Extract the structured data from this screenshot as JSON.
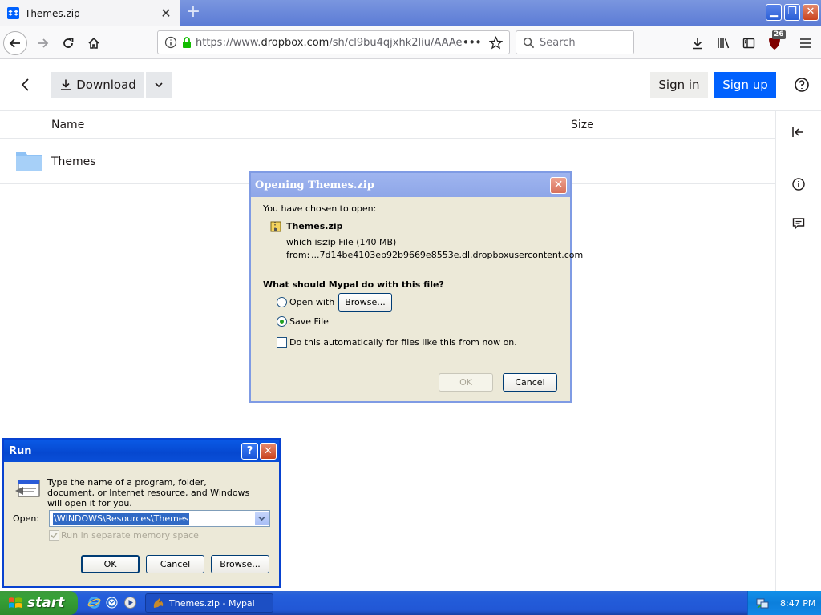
{
  "browser": {
    "tab_title": "Themes.zip",
    "url_prefix": "https://www.",
    "url_domain": "dropbox.com",
    "url_rest": "/sh/cl9bu4qjxhk2liu/AAAe",
    "search_placeholder": "Search",
    "notification_badge": "26"
  },
  "page": {
    "download_label": "Download",
    "signin_label": "Sign in",
    "signup_label": "Sign up",
    "column_name": "Name",
    "column_size": "Size",
    "rows": [
      {
        "name": "Themes",
        "size": ""
      }
    ]
  },
  "open_dialog": {
    "title": "Opening Themes.zip",
    "intro": "You have chosen to open:",
    "filename": "Themes.zip",
    "which_is_label": "which is:",
    "which_is_value": "zip File (140 MB)",
    "from_label": "from:",
    "from_value": "...7d14be4103eb92b9669e8553e.dl.dropboxusercontent.com",
    "question": "What should Mypal do with this file?",
    "open_with_label": "Open with",
    "browse_label": "Browse...",
    "save_file_label": "Save File",
    "auto_label": "Do this automatically for files like this from now on.",
    "ok_label": "OK",
    "cancel_label": "Cancel"
  },
  "run_dialog": {
    "title": "Run",
    "description": "Type the name of a program, folder, document, or Internet resource, and Windows will open it for you.",
    "open_label": "Open:",
    "open_value": "\\WINDOWS\\Resources\\Themes",
    "separate_memory_label": "Run in separate memory space",
    "ok_label": "OK",
    "cancel_label": "Cancel",
    "browse_label": "Browse..."
  },
  "taskbar": {
    "start_label": "start",
    "task_label": "Themes.zip - Mypal",
    "clock": "8:47 PM"
  },
  "colors": {
    "dropbox_blue": "#0061fe",
    "folder_blue": "#8fc2f5",
    "xp_blue": "#245edb",
    "xp_green": "#37a137"
  }
}
